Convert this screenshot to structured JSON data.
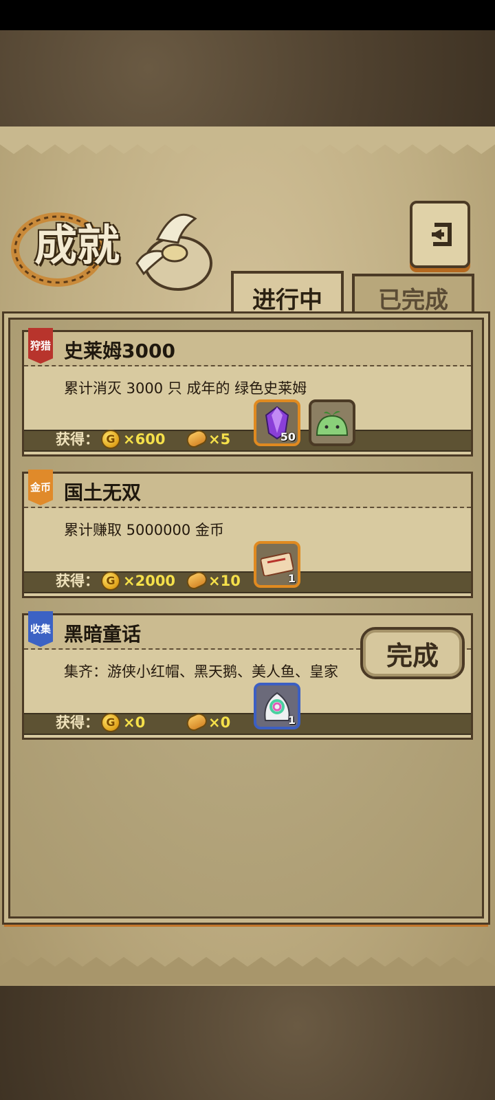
{
  "header": {
    "title": "成就",
    "tabs": [
      {
        "label": "进行中",
        "active": true
      },
      {
        "label": "已完成",
        "active": false
      }
    ]
  },
  "rewards_label": "获得：",
  "achievements": [
    {
      "tag": "狩猎",
      "tag_color": "#b8342c",
      "title": "史莱姆3000",
      "description": "累计消灭 3000 只 成年的 绿色史莱姆",
      "gold": "×600",
      "bread": "×5",
      "items": [
        {
          "icon": "purple-crystal-icon",
          "count": "50"
        },
        {
          "icon": "green-slime-icon",
          "count": ""
        }
      ]
    },
    {
      "tag": "金币",
      "tag_color": "#e08a2a",
      "title": "国土无双",
      "description": "累计赚取 5000000 金币",
      "gold": "×2000",
      "bread": "×10",
      "items": [
        {
          "icon": "ticket-icon",
          "count": "1"
        }
      ]
    },
    {
      "tag": "收集",
      "tag_color": "#3c62c4",
      "title": "黑暗童话",
      "description": "集齐：游侠小红帽、黑天鹅、美人鱼、皇家",
      "gold": "×0",
      "bread": "×0",
      "items": [
        {
          "icon": "rainbow-egg-icon",
          "count": "1"
        }
      ],
      "action_label": "完成"
    }
  ],
  "colors": {
    "gold_text": "#f5e04a",
    "frame_border": "#4b3a25",
    "highlight_orange": "#e08a20"
  }
}
